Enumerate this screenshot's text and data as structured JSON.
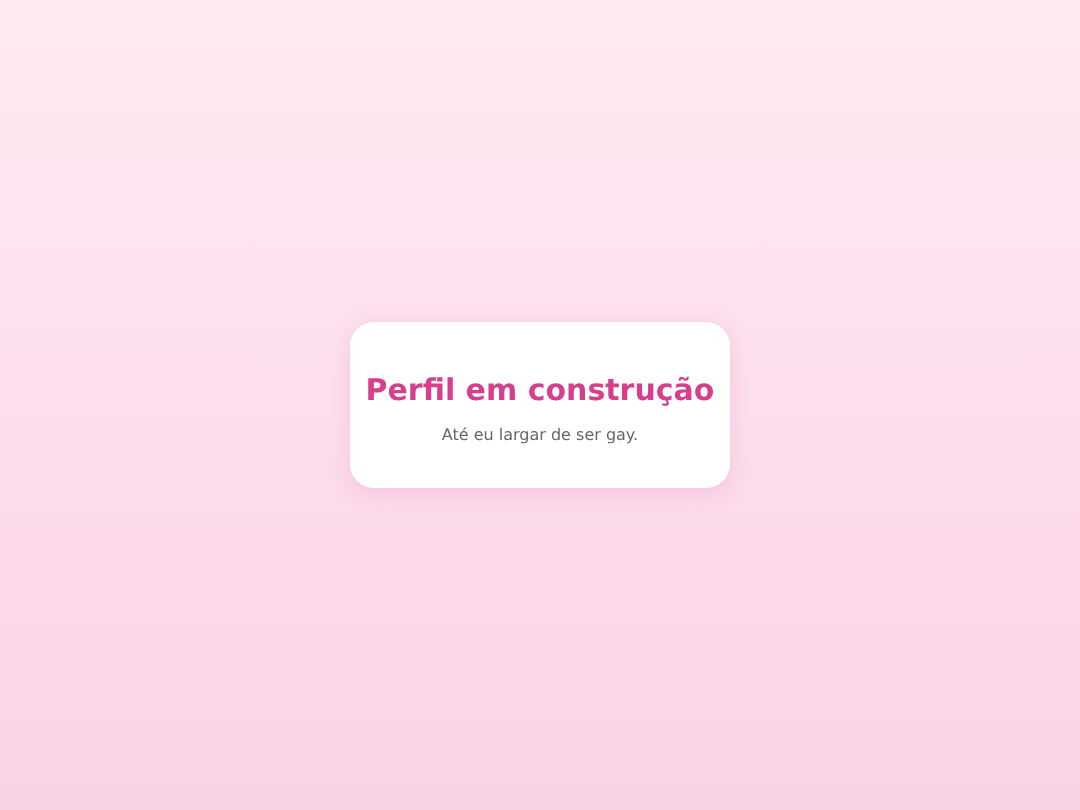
{
  "card": {
    "title": "Perfil em construção",
    "subtitle": "Até eu largar de ser gay."
  }
}
